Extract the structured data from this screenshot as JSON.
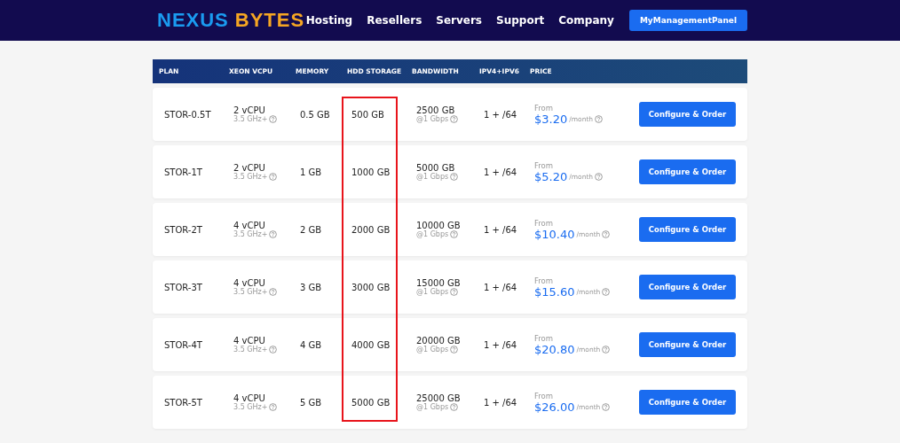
{
  "brand": {
    "part_1": "NEXUS",
    "part_2": "BYTES"
  },
  "nav": {
    "links": [
      "Hosting",
      "Resellers",
      "Servers",
      "Support",
      "Company"
    ],
    "panel_button": "MyManagementPanel"
  },
  "table": {
    "columns": [
      {
        "label": "PLAN",
        "highlighted": false
      },
      {
        "label": "XEON VCPU",
        "highlighted": false
      },
      {
        "label": "MEMORY",
        "highlighted": false
      },
      {
        "label": "HDD STORAGE",
        "highlighted": true
      },
      {
        "label": "BANDWIDTH",
        "highlighted": false
      },
      {
        "label": "IPV4+IPV6",
        "highlighted": false
      },
      {
        "label": "PRICE",
        "highlighted": false
      }
    ],
    "rows": [
      {
        "plan": "STOR-0.5T",
        "vcpu": "2 vCPU",
        "clock": "3.5 GHz+",
        "memory": "0.5 GB",
        "storage": "500 GB",
        "bandwidth": "2500 GB",
        "speed": "@1 Gbps",
        "ip": "1 + /64",
        "from": "From",
        "price": "$3.20",
        "period": "/month",
        "button": "Configure & Order"
      },
      {
        "plan": "STOR-1T",
        "vcpu": "2 vCPU",
        "clock": "3.5 GHz+",
        "memory": "1 GB",
        "storage": "1000 GB",
        "bandwidth": "5000 GB",
        "speed": "@1 Gbps",
        "ip": "1 + /64",
        "from": "From",
        "price": "$5.20",
        "period": "/month",
        "button": "Configure & Order"
      },
      {
        "plan": "STOR-2T",
        "vcpu": "4 vCPU",
        "clock": "3.5 GHz+",
        "memory": "2 GB",
        "storage": "2000 GB",
        "bandwidth": "10000 GB",
        "speed": "@1 Gbps",
        "ip": "1 + /64",
        "from": "From",
        "price": "$10.40",
        "period": "/month",
        "button": "Configure & Order"
      },
      {
        "plan": "STOR-3T",
        "vcpu": "4 vCPU",
        "clock": "3.5 GHz+",
        "memory": "3 GB",
        "storage": "3000 GB",
        "bandwidth": "15000 GB",
        "speed": "@1 Gbps",
        "ip": "1 + /64",
        "from": "From",
        "price": "$15.60",
        "period": "/month",
        "button": "Configure & Order"
      },
      {
        "plan": "STOR-4T",
        "vcpu": "4 vCPU",
        "clock": "3.5 GHz+",
        "memory": "4 GB",
        "storage": "4000 GB",
        "bandwidth": "20000 GB",
        "speed": "@1 Gbps",
        "ip": "1 + /64",
        "from": "From",
        "price": "$20.80",
        "period": "/month",
        "button": "Configure & Order"
      },
      {
        "plan": "STOR-5T",
        "vcpu": "4 vCPU",
        "clock": "3.5 GHz+",
        "memory": "5 GB",
        "storage": "5000 GB",
        "bandwidth": "25000 GB",
        "speed": "@1 Gbps",
        "ip": "1 + /64",
        "from": "From",
        "price": "$26.00",
        "period": "/month",
        "button": "Configure & Order"
      }
    ]
  }
}
